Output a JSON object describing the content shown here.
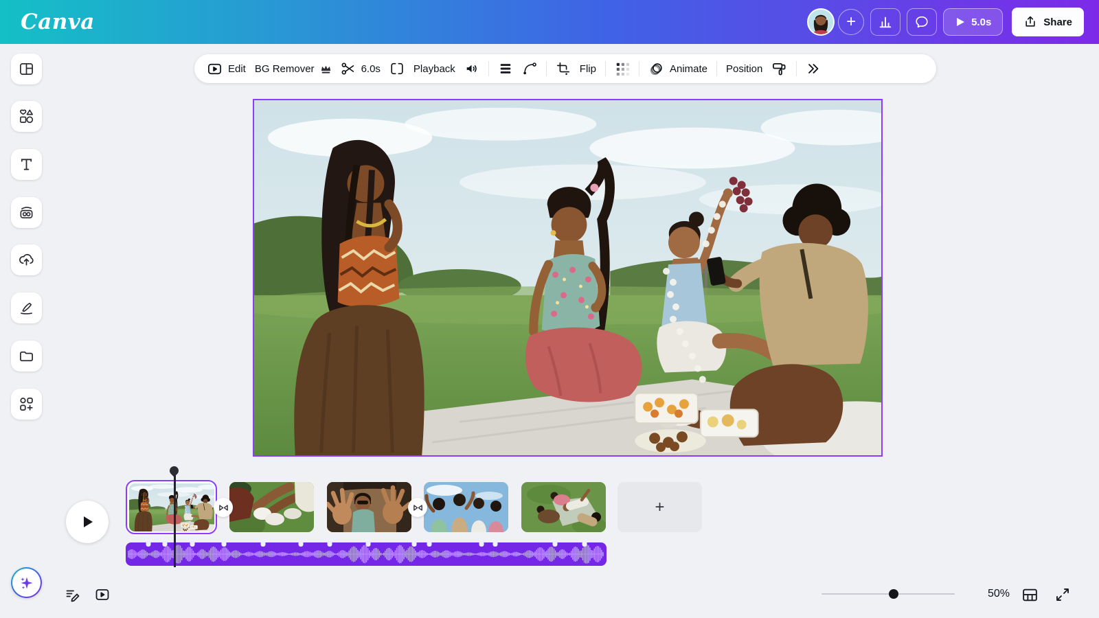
{
  "topbar": {
    "logo": "Canva",
    "duration": "5.0s",
    "share": "Share"
  },
  "toolbar": {
    "edit": "Edit",
    "bg_remover": "BG Remover",
    "trim": "6.0s",
    "playback": "Playback",
    "flip": "Flip",
    "animate": "Animate",
    "position": "Position"
  },
  "sidebar": {
    "items": [
      "design",
      "elements",
      "text",
      "brand",
      "uploads",
      "draw",
      "projects",
      "apps"
    ]
  },
  "timeline": {
    "clips": [
      "picnic-group",
      "legs-on-grass",
      "hands-in-car",
      "friends-blue-sky",
      "lying-on-grass"
    ],
    "transitions_after_clips": [
      1,
      3
    ],
    "add_clip": "+"
  },
  "statusbar": {
    "zoom": "50%"
  },
  "icons": {
    "plus": "+"
  },
  "colors": {
    "accent_purple": "#8b3dff",
    "brand_teal": "#14c0c6",
    "brand_purple": "#7d2ae8",
    "audio_track": "#7527e8"
  }
}
